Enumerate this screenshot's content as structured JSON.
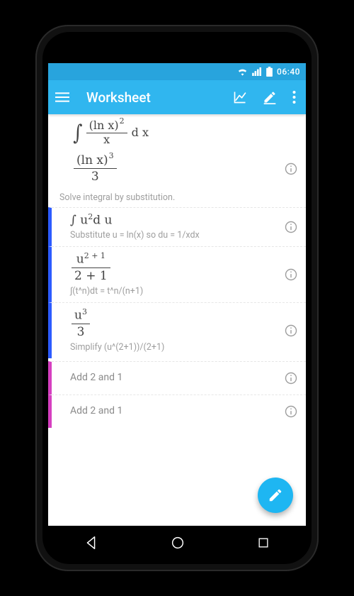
{
  "status": {
    "time": "06:40"
  },
  "appbar": {
    "title": "Worksheet"
  },
  "input_expr": {
    "numerator_base": "(ln x)",
    "numerator_exp": "2",
    "denominator": "x",
    "differential": "d x"
  },
  "result_expr": {
    "numerator_base": "(ln x)",
    "numerator_exp": "3",
    "denominator": "3"
  },
  "steps": [
    {
      "marker": "blue",
      "note_above": "Solve integral by substitution.",
      "math_html": "∫ u<span class='sup'>2</span>d u",
      "note_below": "Substitute u = ln(x) so du = 1/xdx"
    },
    {
      "marker": "blue",
      "frac": {
        "num": "u<span class='sup'>2 + 1</span>",
        "den": "2 + 1"
      },
      "note_below": "∫(t^n)dt = t^n/(n+1)"
    },
    {
      "marker": "blue",
      "frac": {
        "num": "u<span class='sup'>3</span>",
        "den": "3"
      },
      "note_below": "Simplify (u^(2+1))/(2+1)"
    },
    {
      "marker": "magenta",
      "plain": "Add 2 and 1"
    },
    {
      "marker": "magenta",
      "plain": "Add 2 and 1"
    }
  ]
}
